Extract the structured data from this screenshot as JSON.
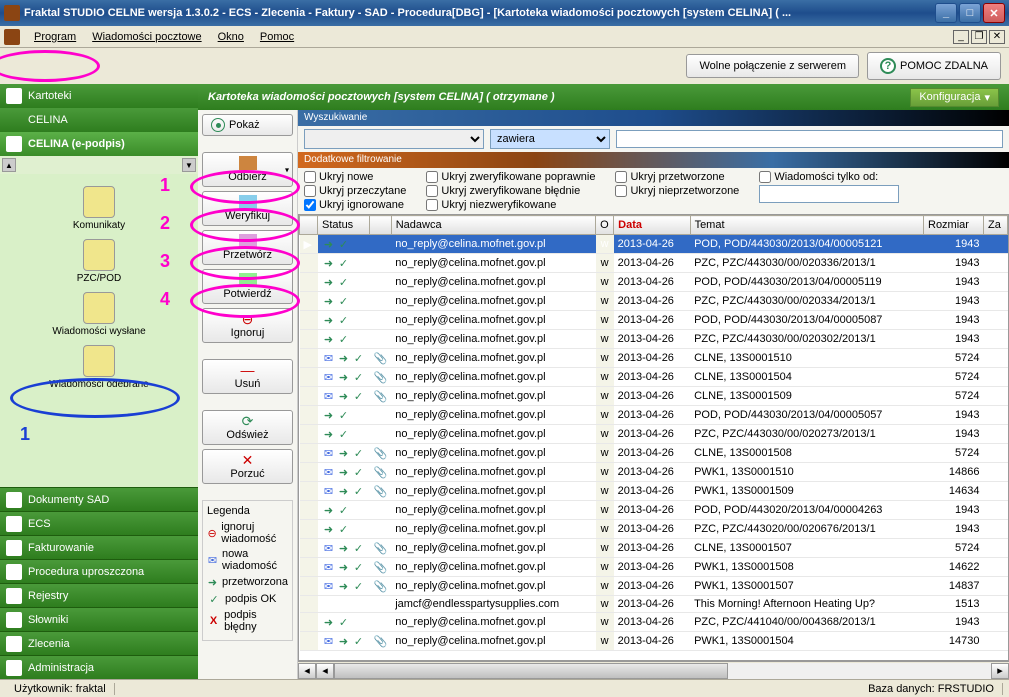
{
  "window": {
    "title": "Fraktal STUDIO CELNE  wersja 1.3.0.2 - ECS - Zlecenia - Faktury - SAD - Procedura[DBG] - [Kartoteka wiadomości pocztowych [system CELINA] ( ..."
  },
  "menu": {
    "items": [
      "Program",
      "Wiadomości pocztowe",
      "Okno",
      "Pomoc"
    ]
  },
  "topbuttons": {
    "connection": "Wolne połączenie z serwerem",
    "help": "POMOC ZDALNA"
  },
  "sidebar": {
    "top": [
      {
        "label": "Kartoteki"
      },
      {
        "label": "CELINA"
      },
      {
        "label": "CELINA (e-podpis)"
      }
    ],
    "items": [
      {
        "label": "Komunikaty"
      },
      {
        "label": "PZC/POD"
      },
      {
        "label": "Wiadomości wysłane"
      },
      {
        "label": "Wiadomości odebrane"
      }
    ],
    "bottom": [
      {
        "label": "Dokumenty SAD"
      },
      {
        "label": "ECS"
      },
      {
        "label": "Fakturowanie"
      },
      {
        "label": "Procedura uproszczona"
      },
      {
        "label": "Rejestry"
      },
      {
        "label": "Słowniki"
      },
      {
        "label": "Zlecenia"
      },
      {
        "label": "Administracja"
      }
    ]
  },
  "content": {
    "title": "Kartoteka wiadomości pocztowych [system CELINA] ( otrzymane )",
    "config": "Konfiguracja"
  },
  "toolbar": {
    "pokaz": "Pokaż",
    "buttons": [
      "Odbierz",
      "Weryfikuj",
      "Przetwórz",
      "Potwierdź",
      "Ignoruj",
      "Usuń",
      "Odśwież",
      "Porzuć"
    ]
  },
  "legend": {
    "title": "Legenda",
    "items": [
      {
        "icon": "ignore",
        "label": "ignoruj wiadomość"
      },
      {
        "icon": "new",
        "label": "nowa wiadomość"
      },
      {
        "icon": "processed",
        "label": "przetworzona"
      },
      {
        "icon": "sigok",
        "label": "podpis OK"
      },
      {
        "icon": "sigbad",
        "label": "podpis błędny"
      }
    ]
  },
  "search": {
    "title": "Wyszukiwanie",
    "contains": "zawiera"
  },
  "filter": {
    "title": "Dodatkowe filtrowanie",
    "col1": [
      "Ukryj nowe",
      "Ukryj przeczytane",
      "Ukryj ignorowane"
    ],
    "col2": [
      "Ukryj zweryfikowane poprawnie",
      "Ukryj zweryfikowane błędnie",
      "Ukryj niezweryfikowane"
    ],
    "col3": [
      "Ukryj przetworzone",
      "Ukryj nieprzetworzone"
    ],
    "col4": "Wiadomości tylko od:"
  },
  "table": {
    "headers": [
      "",
      "Status",
      "",
      "Nadawca",
      "O",
      "Data",
      "Temat",
      "Rozmiar",
      "Za"
    ],
    "rows": [
      {
        "s": "pv",
        "a": "",
        "n": "no_reply@celina.mofnet.gov.pl",
        "o": "w",
        "d": "2013-04-26",
        "t": "POD, POD/443030/2013/04/00005121",
        "r": "1943",
        "sel": true
      },
      {
        "s": "pv",
        "a": "",
        "n": "no_reply@celina.mofnet.gov.pl",
        "o": "w",
        "d": "2013-04-26",
        "t": "PZC, PZC/443030/00/020336/2013/1",
        "r": "1943"
      },
      {
        "s": "pv",
        "a": "",
        "n": "no_reply@celina.mofnet.gov.pl",
        "o": "w",
        "d": "2013-04-26",
        "t": "POD, POD/443030/2013/04/00005119",
        "r": "1943"
      },
      {
        "s": "pv",
        "a": "",
        "n": "no_reply@celina.mofnet.gov.pl",
        "o": "w",
        "d": "2013-04-26",
        "t": "PZC, PZC/443030/00/020334/2013/1",
        "r": "1943"
      },
      {
        "s": "pv",
        "a": "",
        "n": "no_reply@celina.mofnet.gov.pl",
        "o": "w",
        "d": "2013-04-26",
        "t": "POD, POD/443030/2013/04/00005087",
        "r": "1943"
      },
      {
        "s": "pv",
        "a": "",
        "n": "no_reply@celina.mofnet.gov.pl",
        "o": "w",
        "d": "2013-04-26",
        "t": "PZC, PZC/443030/00/020302/2013/1",
        "r": "1943"
      },
      {
        "s": "mpv",
        "a": "c",
        "n": "no_reply@celina.mofnet.gov.pl",
        "o": "w",
        "d": "2013-04-26",
        "t": "CLNE, 13S0001510",
        "r": "5724"
      },
      {
        "s": "mpv",
        "a": "c",
        "n": "no_reply@celina.mofnet.gov.pl",
        "o": "w",
        "d": "2013-04-26",
        "t": "CLNE, 13S0001504",
        "r": "5724"
      },
      {
        "s": "mpv",
        "a": "c",
        "n": "no_reply@celina.mofnet.gov.pl",
        "o": "w",
        "d": "2013-04-26",
        "t": "CLNE, 13S0001509",
        "r": "5724"
      },
      {
        "s": "pv",
        "a": "",
        "n": "no_reply@celina.mofnet.gov.pl",
        "o": "w",
        "d": "2013-04-26",
        "t": "POD, POD/443030/2013/04/00005057",
        "r": "1943"
      },
      {
        "s": "pv",
        "a": "",
        "n": "no_reply@celina.mofnet.gov.pl",
        "o": "w",
        "d": "2013-04-26",
        "t": "PZC, PZC/443030/00/020273/2013/1",
        "r": "1943"
      },
      {
        "s": "mpv",
        "a": "c",
        "n": "no_reply@celina.mofnet.gov.pl",
        "o": "w",
        "d": "2013-04-26",
        "t": "CLNE, 13S0001508",
        "r": "5724"
      },
      {
        "s": "mpv",
        "a": "c",
        "n": "no_reply@celina.mofnet.gov.pl",
        "o": "w",
        "d": "2013-04-26",
        "t": "PWK1, 13S0001510",
        "r": "14866"
      },
      {
        "s": "mpv",
        "a": "c",
        "n": "no_reply@celina.mofnet.gov.pl",
        "o": "w",
        "d": "2013-04-26",
        "t": "PWK1, 13S0001509",
        "r": "14634"
      },
      {
        "s": "pv",
        "a": "",
        "n": "no_reply@celina.mofnet.gov.pl",
        "o": "w",
        "d": "2013-04-26",
        "t": "POD, POD/443020/2013/04/00004263",
        "r": "1943"
      },
      {
        "s": "pv",
        "a": "",
        "n": "no_reply@celina.mofnet.gov.pl",
        "o": "w",
        "d": "2013-04-26",
        "t": "PZC, PZC/443020/00/020676/2013/1",
        "r": "1943"
      },
      {
        "s": "mpv",
        "a": "c",
        "n": "no_reply@celina.mofnet.gov.pl",
        "o": "w",
        "d": "2013-04-26",
        "t": "CLNE, 13S0001507",
        "r": "5724"
      },
      {
        "s": "mpv",
        "a": "c",
        "n": "no_reply@celina.mofnet.gov.pl",
        "o": "w",
        "d": "2013-04-26",
        "t": "PWK1, 13S0001508",
        "r": "14622"
      },
      {
        "s": "mpv",
        "a": "c",
        "n": "no_reply@celina.mofnet.gov.pl",
        "o": "w",
        "d": "2013-04-26",
        "t": "PWK1, 13S0001507",
        "r": "14837"
      },
      {
        "s": "",
        "a": "",
        "n": "jamcf@endlesspartysupplies.com",
        "o": "w",
        "d": "2013-04-26",
        "t": "This Morning! Afternoon Heating Up?",
        "r": "1513"
      },
      {
        "s": "pv",
        "a": "",
        "n": "no_reply@celina.mofnet.gov.pl",
        "o": "w",
        "d": "2013-04-26",
        "t": "PZC, PZC/441040/00/004368/2013/1",
        "r": "1943"
      },
      {
        "s": "mpv",
        "a": "c",
        "n": "no_reply@celina.mofnet.gov.pl",
        "o": "w",
        "d": "2013-04-26",
        "t": "PWK1, 13S0001504",
        "r": "14730"
      }
    ]
  },
  "statusbar": {
    "user": "Użytkownik: fraktal",
    "db": "Baza danych: FRSTUDIO"
  },
  "annotations": {
    "nums": [
      "1",
      "2",
      "3",
      "4"
    ],
    "bluenum": "1"
  }
}
